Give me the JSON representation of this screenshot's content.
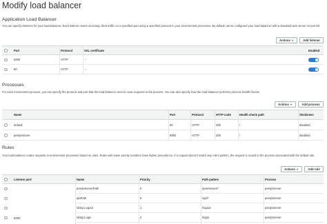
{
  "page_title": "Modify load balancer",
  "alb": {
    "title": "Application Load Balancer",
    "description": "You can specify listeners for your load balancer. Each listener routes incoming client traffic on a specified port using a specified protocol to your environment processes. By default, we've configured your load balancer with a standard web server on port 80.",
    "actions_label": "Actions",
    "add_label": "Add listener",
    "columns": [
      "Port",
      "Protocol",
      "SSL certificate",
      "Enabled"
    ],
    "rows": [
      {
        "port": "5000",
        "protocol": "HTTP",
        "ssl": "--",
        "enabled": true
      },
      {
        "port": "80",
        "protocol": "HTTP",
        "ssl": "--",
        "enabled": true
      }
    ]
  },
  "processes": {
    "title": "Processes",
    "description": "For each environment process, you can specify the protocol and port that the load balancer uses to route requests to the process. You can also specify how the load balancer performs process health checks.",
    "actions_label": "Actions",
    "add_label": "Add process",
    "columns": [
      "Name",
      "Port",
      "Protocol",
      "HTTP code",
      "Health check path",
      "Stickiness"
    ],
    "rows": [
      {
        "name": "default",
        "port": "80",
        "protocol": "HTTP",
        "code": "200",
        "path": "/",
        "stickiness": "disabled"
      },
      {
        "name": "peerjsServer",
        "port": "9000",
        "protocol": "HTTP",
        "code": "200",
        "path": "/",
        "stickiness": "disabled"
      }
    ]
  },
  "rules": {
    "title": "Rules",
    "description": "Your load balancer routes requests to environment processes based on rules. Rules with lower priority numbers have higher precedence. If a request doesn't match any rule's pattern, the request is routed to the process associated with the default rule.",
    "actions_label": "Actions",
    "add_label": "Add rule",
    "columns": [
      "Listener port",
      "Name",
      "Priority",
      "Path pattern",
      "Process"
    ],
    "listener_port": "5000",
    "rows": [
      {
        "name": "peerjsServerPath",
        "priority": "5",
        "path": "/peerserver/*",
        "process": "peerjsServer"
      },
      {
        "name": "apiPath",
        "priority": "6",
        "path": "/api/*",
        "process": "peerjsServer"
      },
      {
        "name": "lobby:Logout",
        "priority": "1",
        "path": "/logout",
        "process": "peerjsServer"
      },
      {
        "name": "lobby:Login",
        "priority": "2",
        "path": "/login",
        "process": "peerjsServer"
      }
    ]
  }
}
